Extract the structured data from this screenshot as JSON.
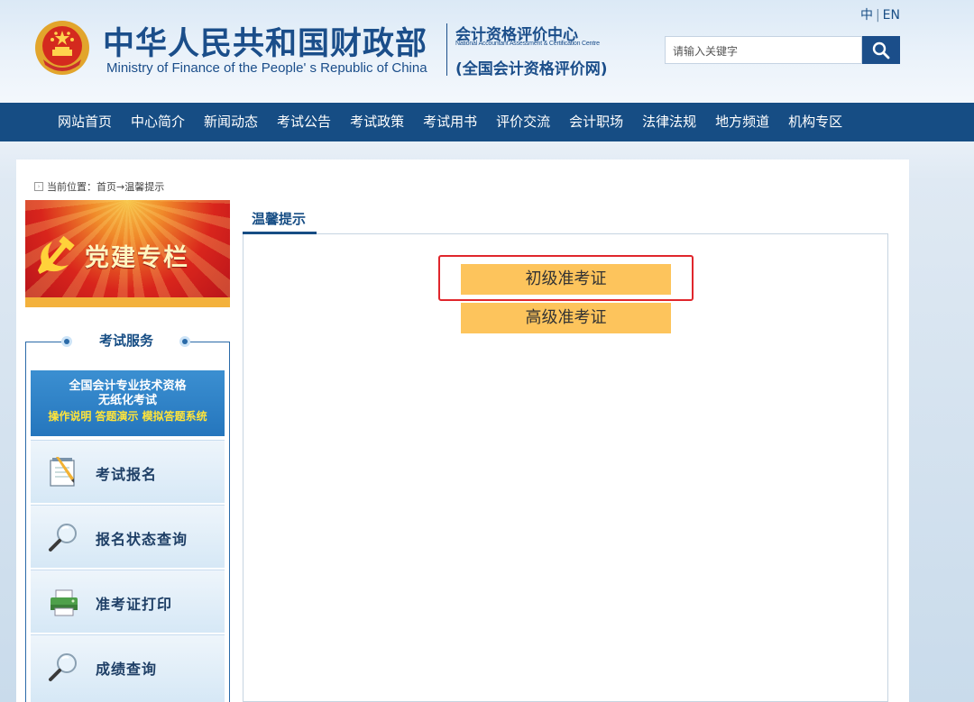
{
  "header": {
    "lang_zh": "中",
    "lang_sep": "|",
    "lang_en": "EN",
    "title_cn": "中华人民共和国财政部",
    "title_en": "Ministry of Finance of the People' s Republic of China",
    "center_cn": "会计资格评价中心",
    "center_en": "National Accountant Assessment & Certification Centre",
    "center_net": "(全国会计资格评价网)",
    "search_placeholder": "请输入关键字"
  },
  "nav": {
    "items": [
      "网站首页",
      "中心简介",
      "新闻动态",
      "考试公告",
      "考试政策",
      "考试用书",
      "评价交流",
      "会计职场",
      "法律法规",
      "地方频道",
      "机构专区"
    ]
  },
  "sidebar": {
    "breadcrumb": "当前位置：首页→温馨提示",
    "banner_text": "党建专栏",
    "service_title": "考试服务",
    "paperless": {
      "line1": "全国会计专业技术资格",
      "line2": "无纸化考试",
      "line3": "操作说明 答题演示 模拟答题系统"
    },
    "items": [
      {
        "label": "考试报名",
        "icon": "notepad-pencil-icon"
      },
      {
        "label": "报名状态查询",
        "icon": "magnifier-icon"
      },
      {
        "label": "准考证打印",
        "icon": "printer-icon"
      },
      {
        "label": "成绩查询",
        "icon": "magnifier-icon"
      }
    ]
  },
  "main": {
    "tab_title": "温馨提示",
    "buttons": [
      "初级准考证",
      "高级准考证"
    ]
  },
  "colors": {
    "nav_bg": "#164d84",
    "button_bg": "#fdc45c",
    "highlight": "#e0262c"
  }
}
